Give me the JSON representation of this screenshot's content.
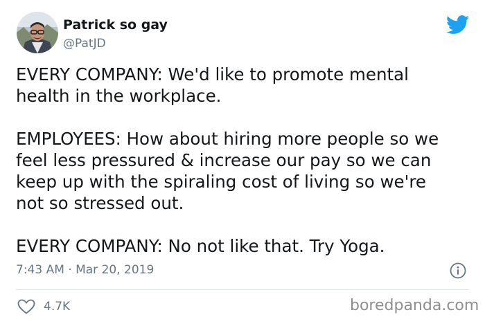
{
  "author": {
    "display_name": "Patrick so gay",
    "handle": "@PatJD",
    "avatar_icon": "profile-photo-avatar"
  },
  "tweet": {
    "lines": [
      "EVERY COMPANY: We'd like to promote mental",
      "health in the workplace.",
      "EMPLOYEES: How about hiring more people so we",
      "feel less pressured & increase our pay so we can",
      "keep up with the spiraling cost of living so we're",
      "not so stressed out.",
      "EVERY COMPANY: No not like that. Try Yoga."
    ],
    "timestamp": "7:43 AM · Mar 20, 2019"
  },
  "engagement": {
    "likes_count": "4.7K"
  },
  "watermark": {
    "text": "boredpanda.com"
  },
  "icons": {
    "brand": "twitter-bird-icon",
    "info": "info-icon",
    "like": "heart-icon"
  },
  "colors": {
    "twitter_blue": "#1da1f2",
    "text_primary": "#14171a",
    "text_secondary": "#657786",
    "divider": "#e1e8ed",
    "watermark": "#8e8e8e"
  }
}
